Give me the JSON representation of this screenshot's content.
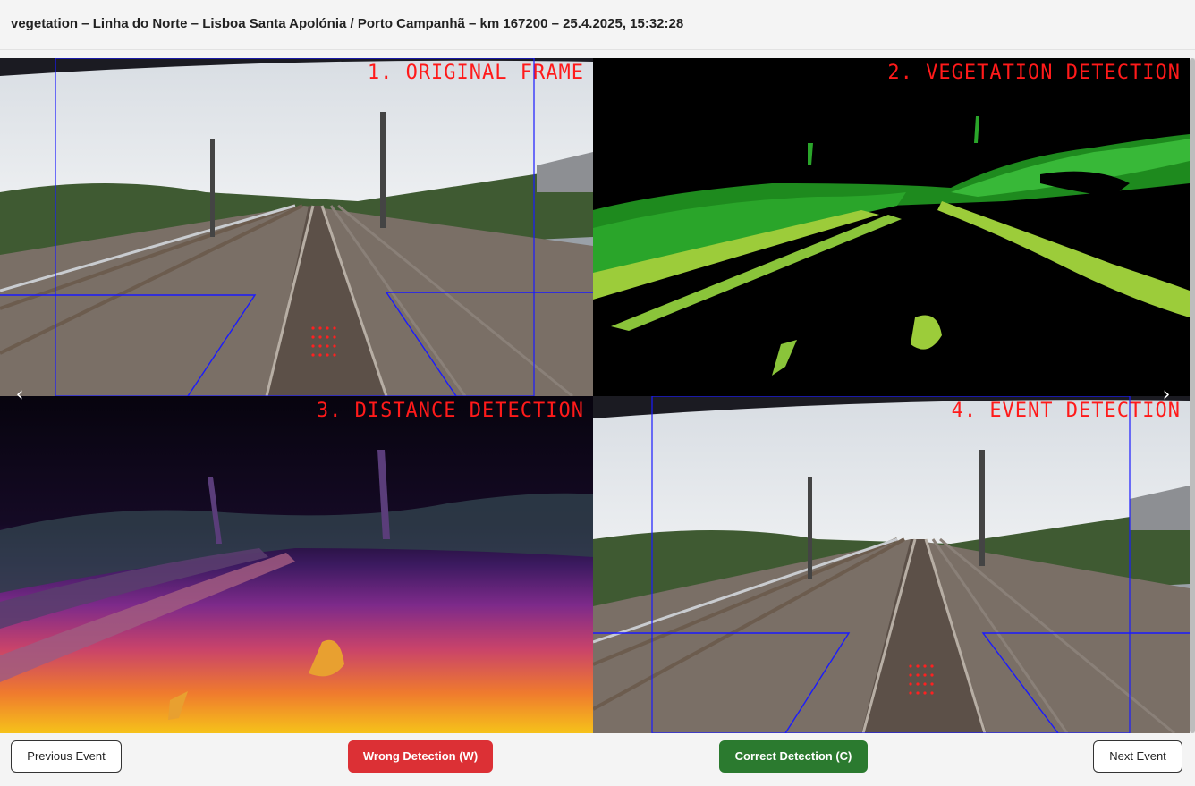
{
  "header": {
    "title": "vegetation – Linha do Norte – Lisboa Santa Apolónia / Porto Campanhã – km 167200 – 25.4.2025, 15:32:28"
  },
  "panels": [
    {
      "label": "1. ORIGINAL FRAME"
    },
    {
      "label": "2. VEGETATION DETECTION"
    },
    {
      "label": "3. DISTANCE DETECTION"
    },
    {
      "label": "4. EVENT DETECTION"
    }
  ],
  "navigation": {
    "prev_arrow": "‹",
    "next_arrow": "›"
  },
  "buttons": {
    "previous": "Previous Event",
    "wrong": "Wrong Detection (W)",
    "correct": "Correct Detection (C)",
    "next": "Next Event"
  },
  "colors": {
    "label_red": "#ff1a1a",
    "wrong_red": "#dc3035",
    "correct_green": "#2b7a2f",
    "roi_blue": "#1a1aff"
  }
}
